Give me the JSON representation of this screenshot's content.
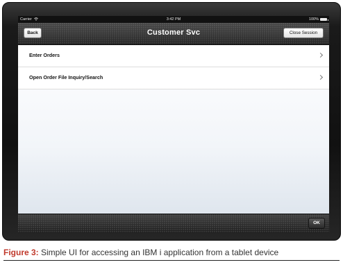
{
  "status_bar": {
    "carrier": "Carrier",
    "time": "3:42 PM",
    "battery": "100%"
  },
  "nav": {
    "back_label": "Back",
    "title": "Customer Svc",
    "close_label": "Close Session"
  },
  "menu": {
    "items": [
      {
        "label": "Enter Orders",
        "icon": "chevron-right-icon"
      },
      {
        "label": "Open Order File Inquiry/Search",
        "icon": "chevron-right-icon"
      }
    ]
  },
  "toolbar": {
    "ok_label": "OK"
  },
  "caption": {
    "label": "Figure 3:",
    "text": "Simple UI for accessing an IBM i application from a tablet device"
  },
  "colors": {
    "caption_label": "#c0392b",
    "nav_background": "#2e2e2e",
    "list_background": "#ffffff"
  }
}
